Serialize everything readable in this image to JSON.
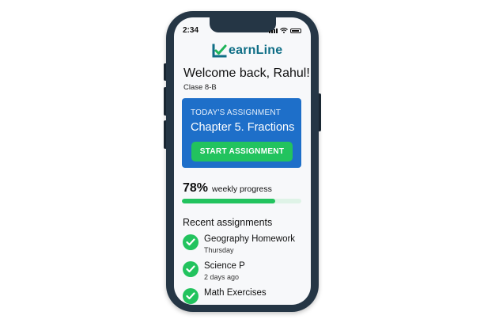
{
  "status_bar": {
    "time": "2:34"
  },
  "brand": {
    "logo_text_main": "earnLine",
    "logo_icon": "check-l-icon",
    "colors": {
      "primary": "#0f6e86",
      "accent": "#1fb45a"
    }
  },
  "header": {
    "welcome": "Welcome back, Rahul!",
    "class_label": "Clase 8-B"
  },
  "assignment_card": {
    "title": "TODAY'S ASSIGNMENT",
    "chapter": "Chapter 5. Fractions",
    "button_label": "START ASSIGNMENT",
    "color": "#1e6fc9",
    "button_color": "#22c35e"
  },
  "progress": {
    "percent_text": "78%",
    "label": "weekly progress",
    "value": 0.78
  },
  "recent": {
    "heading": "Recent assignments",
    "items": [
      {
        "title": "Geography Homework",
        "subtitle": "Thursday",
        "icon": "check-circle-icon"
      },
      {
        "title": "Science P",
        "subtitle": "2 days ago",
        "icon": "check-circle-icon"
      },
      {
        "title": "Math Exercises",
        "subtitle": "",
        "icon": "check-circle-icon"
      }
    ]
  }
}
